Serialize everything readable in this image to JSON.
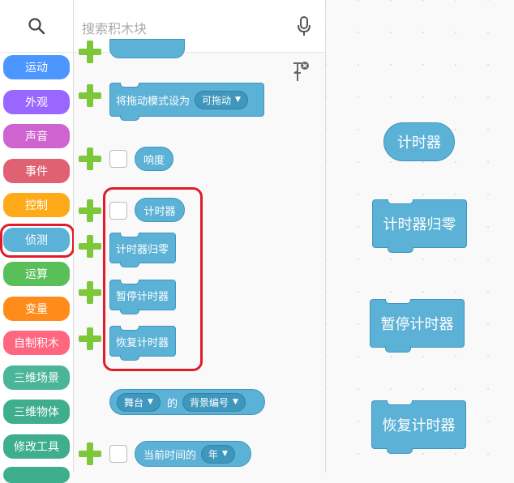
{
  "search": {
    "placeholder": "搜索积木块"
  },
  "categories": [
    {
      "label": "运动",
      "color": "#4c97ff"
    },
    {
      "label": "外观",
      "color": "#9966ff"
    },
    {
      "label": "声音",
      "color": "#cf63cf"
    },
    {
      "label": "事件",
      "color": "#e06272"
    },
    {
      "label": "控制",
      "color": "#ffab19"
    },
    {
      "label": "侦测",
      "color": "#5cb1d6"
    },
    {
      "label": "运算",
      "color": "#59c059"
    },
    {
      "label": "变量",
      "color": "#ff8c1a"
    },
    {
      "label": "自制积木",
      "color": "#ff6680"
    },
    {
      "label": "三维场景",
      "color": "#4bb59a"
    },
    {
      "label": "三维物体",
      "color": "#3fae8d"
    },
    {
      "label": "修改工具",
      "color": "#3fae8d"
    }
  ],
  "palette": {
    "drag_mode_block": {
      "label": "将拖动模式设为",
      "option": "可拖动"
    },
    "loudness": "响度",
    "timer": "计时器",
    "reset_timer": "计时器归零",
    "pause_timer": "暂停计时器",
    "resume_timer": "恢复计时器",
    "stage_block": {
      "object": "舞台",
      "of": "的",
      "attribute": "背景编号"
    },
    "current_time": {
      "label": "当前时间的",
      "option": "年"
    }
  },
  "workspace": {
    "timer": "计时器",
    "reset_timer": "计时器归零",
    "pause_timer": "暂停计时器",
    "resume_timer": "恢复计时器"
  }
}
